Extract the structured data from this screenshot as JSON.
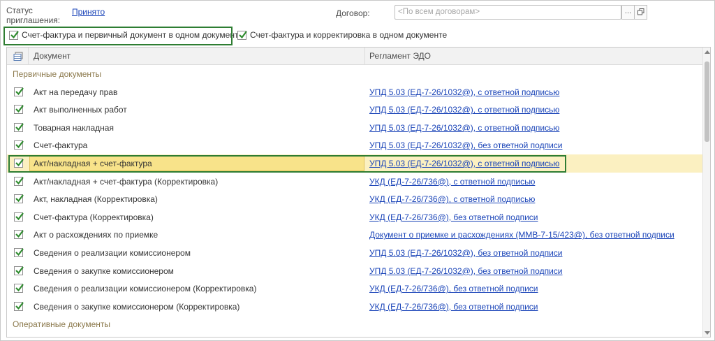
{
  "form": {
    "status_label": "Статус приглашения:",
    "status_value": "Принято",
    "contract_label": "Договор:",
    "contract_placeholder": "<По всем договорам>",
    "contract_select_button": "...",
    "check_invoice_primary": {
      "label": "Счет-фактура и первичный документ в одном документе",
      "checked": true
    },
    "check_invoice_correction": {
      "label": "Счет-фактура и корректировка в одном документе",
      "checked": true
    }
  },
  "table": {
    "headers": {
      "document": "Документ",
      "regulation": "Регламент ЭДО"
    },
    "groups": [
      {
        "title": "Первичные документы",
        "rows": [
          {
            "checked": true,
            "document": "Акт на передачу прав",
            "regulation": "УПД 5.03 (ЕД-7-26/1032@), с ответной подписью",
            "selected": false
          },
          {
            "checked": true,
            "document": "Акт выполненных работ",
            "regulation": "УПД 5.03 (ЕД-7-26/1032@), с ответной подписью",
            "selected": false
          },
          {
            "checked": true,
            "document": "Товарная накладная",
            "regulation": "УПД 5.03 (ЕД-7-26/1032@), с ответной подписью",
            "selected": false
          },
          {
            "checked": true,
            "document": "Счет-фактура",
            "regulation": "УПД 5.03 (ЕД-7-26/1032@), без ответной подписи",
            "selected": false
          },
          {
            "checked": true,
            "document": "Акт/накладная + счет-фактура",
            "regulation": "УПД 5.03 (ЕД-7-26/1032@), с ответной подписью",
            "selected": true
          },
          {
            "checked": true,
            "document": "Акт/накладная + счет-фактура (Корректировка)",
            "regulation": "УКД (ЕД-7-26/736@), с ответной подписью",
            "selected": false
          },
          {
            "checked": true,
            "document": "Акт, накладная (Корректировка)",
            "regulation": "УКД (ЕД-7-26/736@), с ответной подписью",
            "selected": false
          },
          {
            "checked": true,
            "document": "Счет-фактура (Корректировка)",
            "regulation": "УКД (ЕД-7-26/736@), без ответной подписи",
            "selected": false
          },
          {
            "checked": true,
            "document": "Акт о расхождениях по приемке",
            "regulation": "Документ о приемке и расхождениях (ММВ-7-15/423@), без ответной подписи",
            "selected": false
          },
          {
            "checked": true,
            "document": "Сведения о реализации комиссионером",
            "regulation": "УПД 5.03 (ЕД-7-26/1032@), без ответной подписи",
            "selected": false
          },
          {
            "checked": true,
            "document": "Сведения о закупке комиссионером",
            "regulation": "УПД 5.03 (ЕД-7-26/1032@), без ответной подписи",
            "selected": false
          },
          {
            "checked": true,
            "document": "Сведения о реализации комиссионером (Корректировка)",
            "regulation": "УКД (ЕД-7-26/736@), без ответной подписи",
            "selected": false
          },
          {
            "checked": true,
            "document": "Сведения о закупке комиссионером (Корректировка)",
            "regulation": "УКД (ЕД-7-26/736@), без ответной подписи",
            "selected": false
          }
        ]
      },
      {
        "title": "Оперативные документы",
        "rows": []
      }
    ]
  },
  "colors": {
    "link": "#1a44b8",
    "check": "#2e8b2e",
    "group_title": "#8c7a4d",
    "selected_row": "#fbf0c1",
    "selected_cell": "#f8e38a",
    "highlight_frame": "#2e7d32"
  },
  "icons": {
    "header_column_icon": "table-settings-icon",
    "open_button_icon": "open-form-icon",
    "checkbox_icon": "checkmark-icon"
  }
}
